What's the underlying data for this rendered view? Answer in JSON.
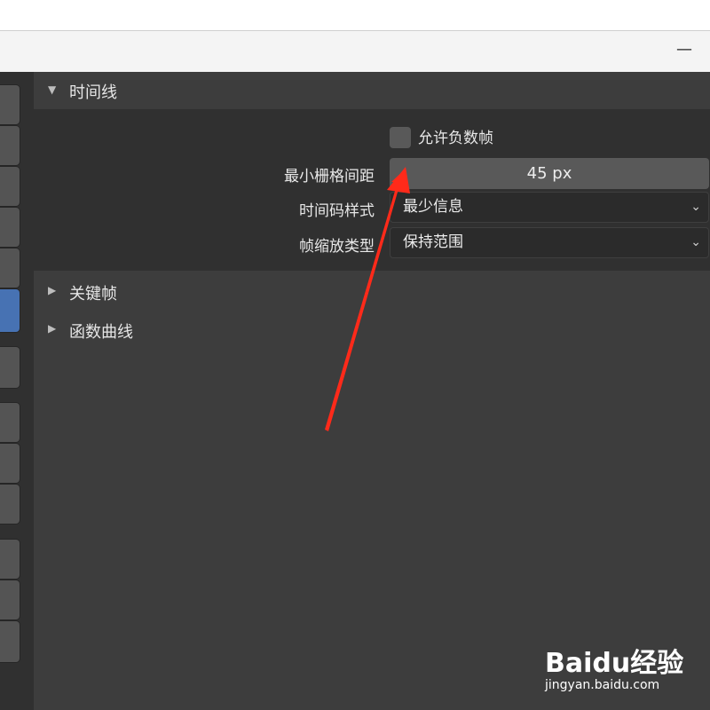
{
  "window": {
    "minimize_glyph": "—"
  },
  "left_tabs": {
    "active_index": 5
  },
  "panel": {
    "title": "时间线",
    "allow_negative_frames_label": "允许负数帧",
    "allow_negative_frames_checked": false,
    "min_grid_spacing_label": "最小栅格间距",
    "min_grid_spacing_value": "45 px",
    "timecode_style_label": "时间码样式",
    "timecode_style_value": "最少信息",
    "zoom_method_label": "帧缩放类型",
    "zoom_method_value": "保持范围"
  },
  "sub_panels": [
    {
      "label": "关键帧",
      "expanded": false
    },
    {
      "label": "函数曲线",
      "expanded": false
    }
  ],
  "icons": {
    "expanded_triangle": "▼",
    "collapsed_triangle": "▶",
    "dropdown_chevron": "⌄"
  },
  "colors": {
    "accent": "#4772b3",
    "annotation_arrow": "#ff2a1a"
  },
  "watermark": {
    "logo": "Baidu经验",
    "url": "jingyan.baidu.com"
  }
}
